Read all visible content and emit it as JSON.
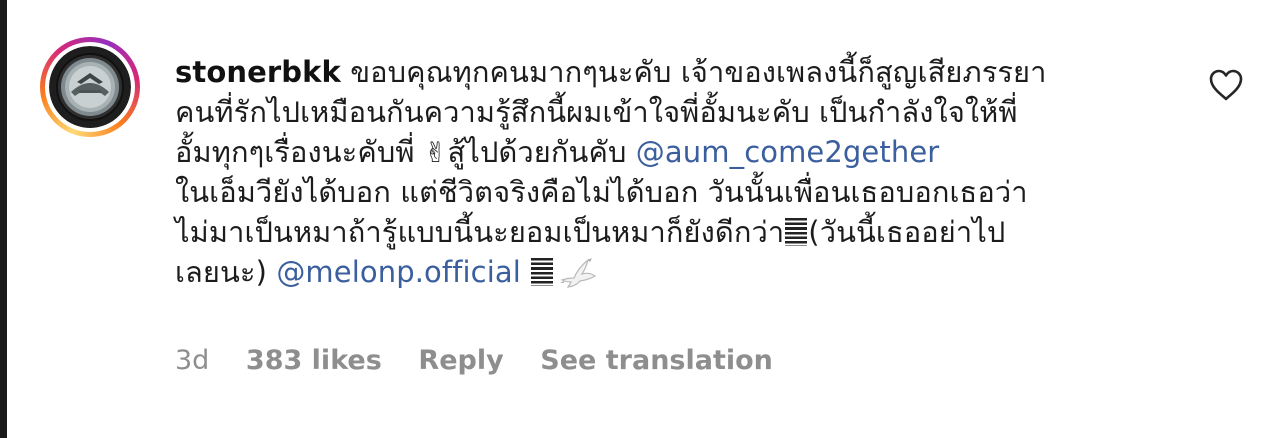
{
  "comment": {
    "username": "stonerbkk",
    "lines": [
      "ขอบคุณทุกคนมากๆนะคับ เจ้าของเพลงนี้ก็สูญเสียภรรยา",
      "คนที่รักไปเหมือนกันความรู้สึกนี้ผมเข้าใจพี่อั้มนะคับ เป็นกำลังใจให้พี่",
      "อั้มทุกๆเรื่องนะคับพี่",
      "สู้ไปด้วยกันคับ",
      "ในเอ็มวียังได้บอก แต่ชีวิตจริงคือไม่ได้บอก วันนั้นเพื่อนเธอบอกเธอว่า",
      "ไม่มาเป็นหมาถ้ารู้แบบนี้นะยอมเป็นหมาก็ยังดีกว่า",
      "(วันนี้เธออย่าไป",
      "เลยนะ)"
    ],
    "emoji_peace": "✌",
    "mention_1": "@aum_come2gether",
    "mention_2": "@melonp.official"
  },
  "meta": {
    "time": "3d",
    "likes": "383 likes",
    "reply": "Reply",
    "see_translation": "See translation"
  },
  "icons": {
    "avatar": "avatar-logo-icon",
    "like": "heart-icon",
    "dove": "dove-icon",
    "bars": "bars-emoji-icon"
  },
  "colors": {
    "mention": "#3b5f9e",
    "meta": "#8e8e8e",
    "story_ring_start": "#feda75",
    "story_ring_end": "#962fbf"
  }
}
